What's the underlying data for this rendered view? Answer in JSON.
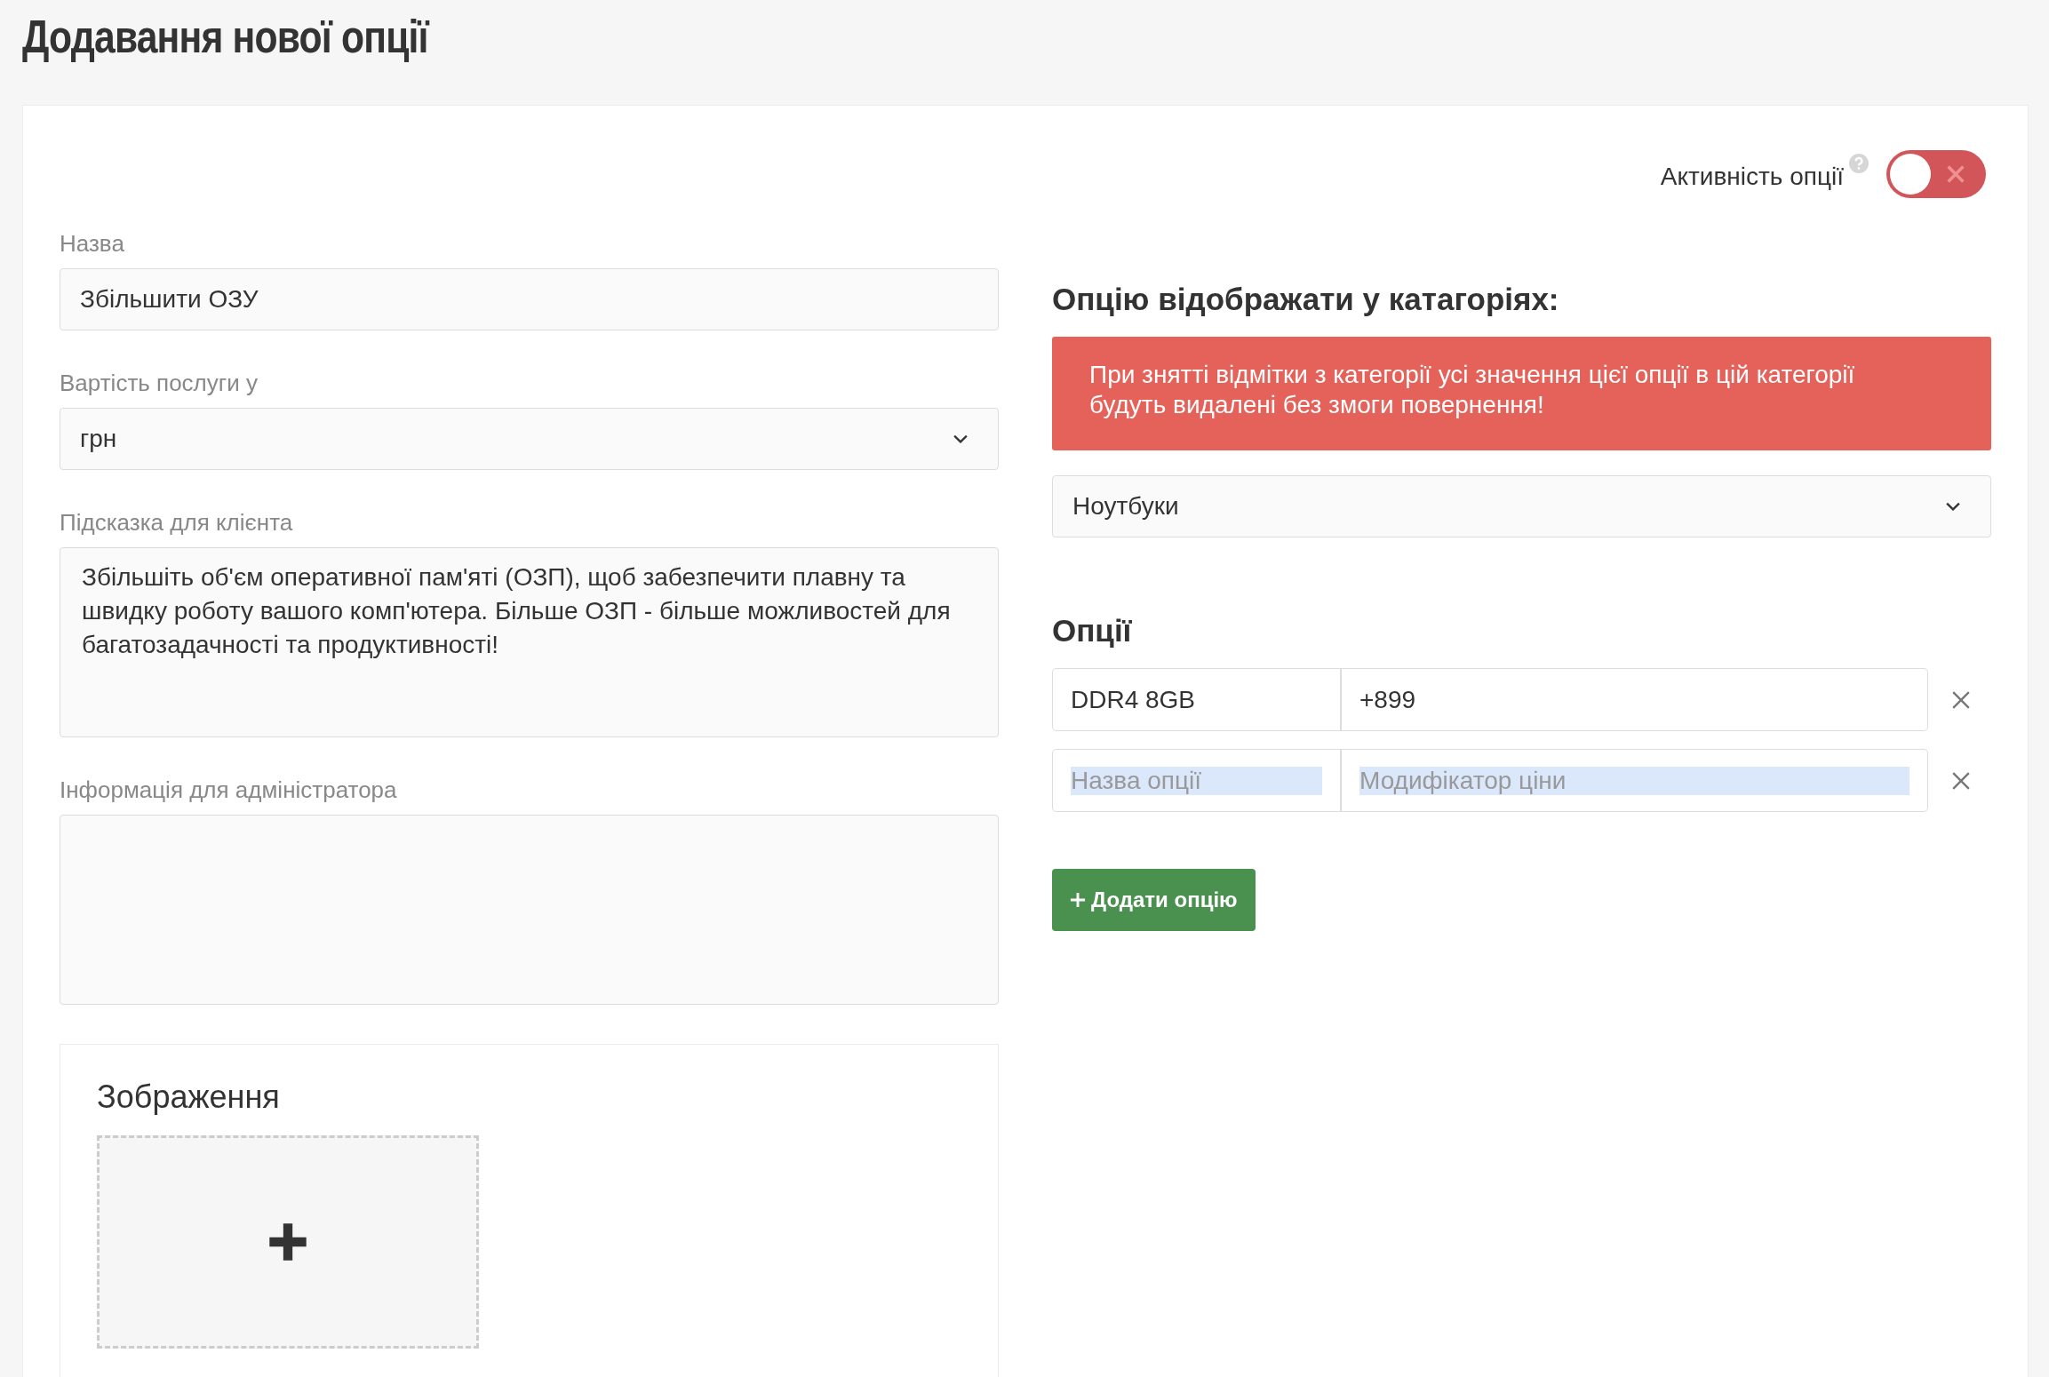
{
  "page_title": "Додавання нової опції",
  "activity": {
    "label": "Активність опції",
    "on": false
  },
  "fields": [
    {
      "kind": "input",
      "label": "Назва",
      "value": "Збільшити ОЗУ"
    },
    {
      "kind": "select",
      "label": "Вартість послуги у",
      "value": "грн"
    },
    {
      "kind": "textarea",
      "label": "Підсказка для клієнта",
      "value": "Збільшіть об'єм оперативної пам'яті (ОЗП), щоб забезпечити плавну та швидку роботу вашого комп'ютера. Більше ОЗП - більше можливостей для багатозадачності та продуктивності!"
    },
    {
      "kind": "textarea",
      "label": "Інформація для адміністратора"
    }
  ],
  "image_section": {
    "title": "Зображення"
  },
  "categories": {
    "title": "Опцію відображати у катагоріях:",
    "warning": "При знятті відмітки з категорії усі значення цієї опції в цій категорії будуть видалені без змоги повернення!",
    "selected": "Ноутбуки"
  },
  "options": {
    "title": "Опції",
    "rows": [
      {
        "name": "DDR4 8GB",
        "price": "+899"
      },
      {
        "name_placeholder": "Назва опції",
        "price_placeholder": "Модифікатор ціни"
      }
    ],
    "add_button": "Додати опцію"
  }
}
